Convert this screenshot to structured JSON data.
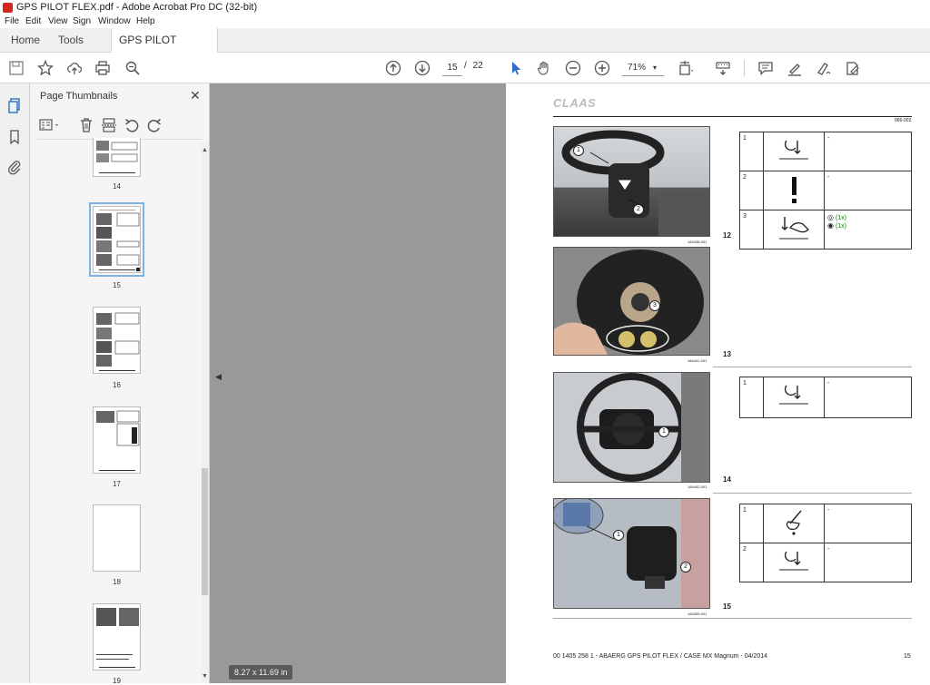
{
  "window": {
    "title": "GPS PILOT FLEX.pdf - Adobe Acrobat Pro DC (32-bit)"
  },
  "menu": [
    "File",
    "Edit",
    "View",
    "Sign",
    "Window",
    "Help"
  ],
  "tabs": {
    "home": "Home",
    "tools": "Tools",
    "document": "GPS PILOT FLEX.pdf",
    "close": "×"
  },
  "toolbar": {
    "current_page": "15",
    "page_separator": "/",
    "total_pages": "22",
    "zoom": "71%",
    "zoom_caret": "▾"
  },
  "thumbnails": {
    "title": "Page Thumbnails",
    "close": "✕",
    "pages": [
      {
        "label": "14"
      },
      {
        "label": "15",
        "selected": true
      },
      {
        "label": "16"
      },
      {
        "label": "17"
      },
      {
        "label": "18"
      },
      {
        "label": "19"
      }
    ]
  },
  "status": {
    "page_size": "8.27 x 11.69 in"
  },
  "document_page": {
    "brand": "CLAAS",
    "doc_code": "966-002",
    "steps": [
      {
        "number": "12",
        "caption": "184438-001",
        "rows": [
          {
            "n": "1",
            "text": "-"
          },
          {
            "n": "2",
            "text": "-"
          },
          {
            "n": "3",
            "text": "",
            "items": [
              "(1x)",
              "(1x)"
            ]
          }
        ]
      },
      {
        "number": "13",
        "caption": "184441-001"
      },
      {
        "number": "14",
        "caption": "184442-001",
        "rows": [
          {
            "n": "1",
            "text": "-"
          }
        ]
      },
      {
        "number": "15",
        "caption": "184309-001",
        "rows": [
          {
            "n": "1",
            "text": "-"
          },
          {
            "n": "2",
            "text": "-"
          }
        ]
      }
    ],
    "footer": "00 1405 258 1 - ABAERG GPS PILOT FLEX / CASE MX Magnum - 04/2014",
    "page_number": "15"
  }
}
